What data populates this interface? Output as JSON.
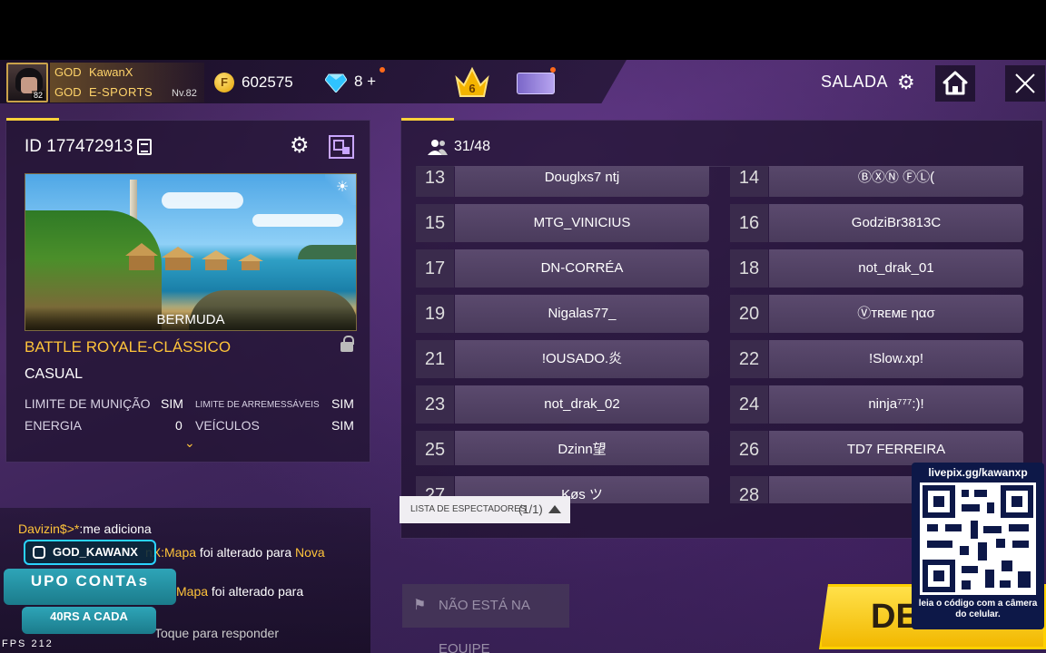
{
  "topbar": {
    "avatar_level": "82",
    "guild_tag_1": "GOD",
    "player_name": "KawanX",
    "guild_tag_2": "GOD",
    "guild_name": "E-SPORTS",
    "level_label": "Nv.82",
    "coin_symbol": "F",
    "coins": "602575",
    "diamonds": "8 +",
    "rank_number": "6",
    "room_label": "SALADA"
  },
  "room": {
    "id_label": "ID 177472913",
    "map_name": "BERMUDA",
    "mode": "BATTLE ROYALE-CLÁSSICO",
    "submode": "CASUAL",
    "options": [
      {
        "label": "LIMITE DE MUNIÇÃO",
        "value": "SIM"
      },
      {
        "label": "LIMITE DE ARREMESSÁVEIS",
        "value": "SIM"
      },
      {
        "label": "ENERGIA",
        "value": "0"
      },
      {
        "label": "VEÍCULOS",
        "value": "SIM"
      }
    ]
  },
  "players": {
    "count": "31/48",
    "slots": [
      {
        "num": "13",
        "name": "Douglxs7    ntj"
      },
      {
        "num": "14",
        "name": "ⒷⓍⓃ   ⒻⓁ("
      },
      {
        "num": "15",
        "name": "MTG_VINICIUS"
      },
      {
        "num": "16",
        "name": "GodziBr3813C"
      },
      {
        "num": "17",
        "name": "DN-CORRÉA"
      },
      {
        "num": "18",
        "name": "not_drak_01"
      },
      {
        "num": "19",
        "name": "Nigalas77_"
      },
      {
        "num": "20",
        "name": "Ⓥᴛʀᴇᴍᴇ ηασ"
      },
      {
        "num": "21",
        "name": "!OUSADO.炎"
      },
      {
        "num": "22",
        "name": "!Slow.xp!"
      },
      {
        "num": "23",
        "name": "not_drak_02"
      },
      {
        "num": "24",
        "name": "ninja⁷⁷⁷:)!"
      },
      {
        "num": "25",
        "name": "Dzinn望"
      },
      {
        "num": "26",
        "name": "TD7    FERREIRA"
      },
      {
        "num": "27",
        "name": "Køs   ツ"
      },
      {
        "num": "28",
        "name": ""
      }
    ]
  },
  "spectators": {
    "label": "LISTA DE ESPECTADORES",
    "count": "(1/1)"
  },
  "buttons": {
    "not_in_team": "NÃO ESTÁ NA EQUIPE",
    "start": "DEC"
  },
  "chat": {
    "lines": [
      {
        "name": "Davizin$>*",
        "text": ":me adiciona"
      },
      {
        "name": "nX:Mapa",
        "text": " foi alterado para ",
        "extra": "Nova"
      },
      {
        "name": "Mapa",
        "text": " foi alterado para"
      }
    ],
    "reply_hint": "Toque para responder",
    "fps": "FPS 212"
  },
  "overlay": {
    "instagram": "GOD_KAWANX",
    "upo": "UPO CONTAs",
    "forty": "40RS A CADA",
    "qr_url": "livepix.gg/kawanxp",
    "qr_hint": "leia o código com a câmera do celular."
  },
  "colors": {
    "accent": "#ffd23a",
    "mode": "#ffc43a",
    "panel": "#2a1a3c"
  }
}
